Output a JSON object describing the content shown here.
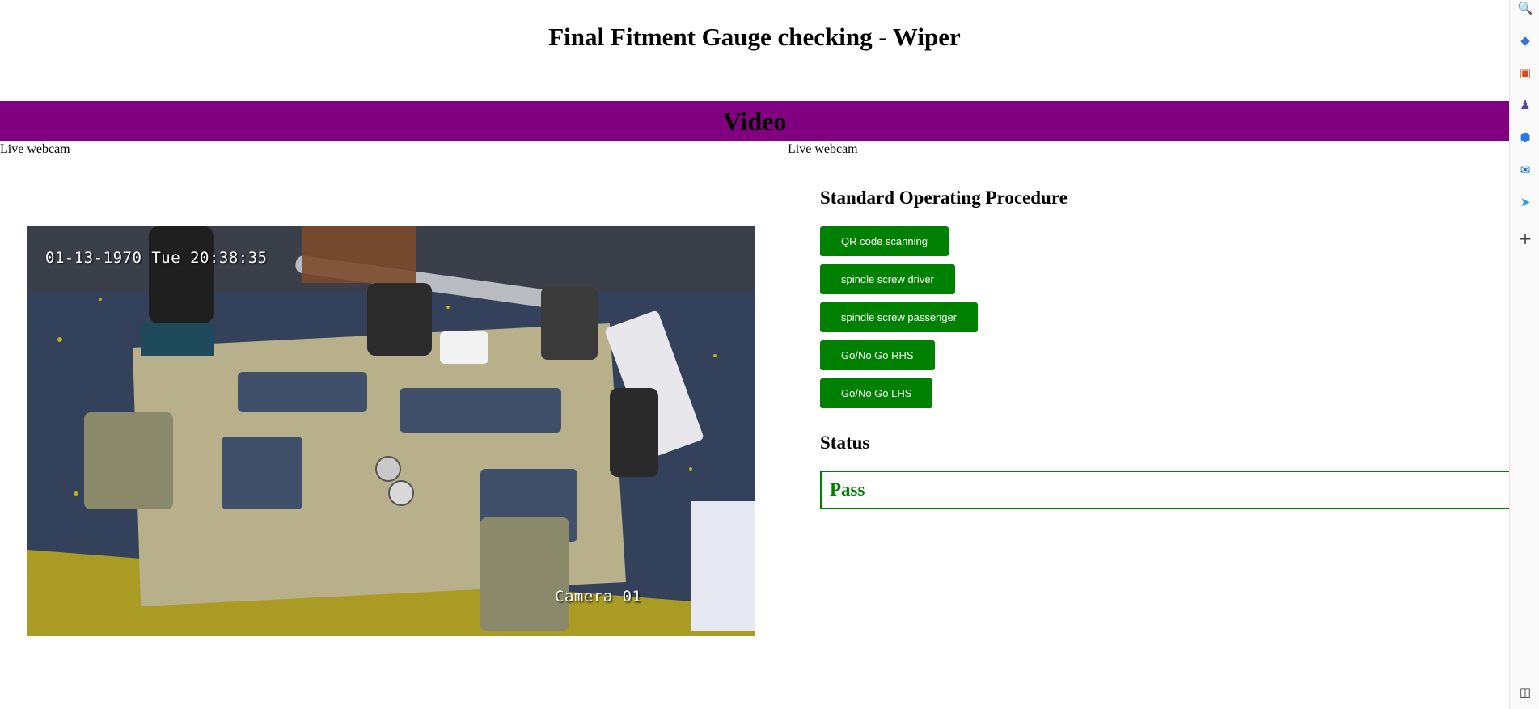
{
  "header": {
    "title": "Final Fitment Gauge checking - Wiper"
  },
  "video_section": {
    "banner_label": "Video",
    "banner_color": "#800080",
    "left_label": "Live webcam",
    "right_label": "Live webcam",
    "camera": {
      "timestamp": "01-13-1970 Tue 20:38:35",
      "name": "Camera 01"
    }
  },
  "sop": {
    "title": "Standard Operating Procedure",
    "button_color": "#008000",
    "buttons": [
      {
        "label": "QR code scanning"
      },
      {
        "label": "spindle screw driver"
      },
      {
        "label": "spindle screw passenger"
      },
      {
        "label": "Go/No Go RHS"
      },
      {
        "label": "Go/No Go LHS"
      }
    ]
  },
  "status": {
    "title": "Status",
    "value": "Pass",
    "color": "#008000"
  },
  "browser_sidebar": {
    "icons": [
      "search-icon",
      "tag-icon",
      "toolbox-icon",
      "chess-icon",
      "copilot-icon",
      "outlook-icon",
      "paper-plane-icon",
      "add-icon",
      "panel-toggle-icon"
    ]
  }
}
